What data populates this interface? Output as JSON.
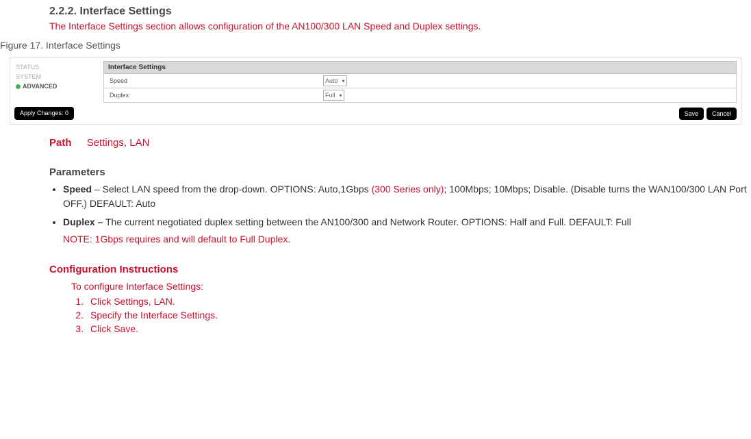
{
  "heading": "2.2.2. Interface Settings",
  "heading_subtext": "The Interface Settings section allows configuration of the AN100/300 LAN Speed and Duplex settings.",
  "figure_caption": "Figure 17. Interface Settings",
  "screenshot": {
    "nav": {
      "item1": "STATUS",
      "item2": "SYSTEM",
      "item3": "ADVANCED"
    },
    "panel_title": "Interface Settings",
    "row1_label": "Speed",
    "row1_value": "Auto",
    "row2_label": "Duplex",
    "row2_value": "Full",
    "apply_btn": "Apply Changes: 0",
    "save_btn": "Save",
    "cancel_btn": "Cancel"
  },
  "path": {
    "label": "Path",
    "value": "Settings, LAN"
  },
  "params_heading": "Parameters",
  "params": {
    "speed_label": "Speed",
    "speed_text1": " – Select LAN speed from the drop-down. OPTIONS: Auto,1Gbps ",
    "speed_red": "(300 Series only)",
    "speed_text2": "; 100Mbps; 10Mbps; Disable. (Disable turns the WAN100/300 LAN Port OFF.) DEFAULT: Auto",
    "duplex_label": "Duplex –",
    "duplex_text": " The current negotiated duplex setting between the AN100/300 and Network Router. OPTIONS: Half and Full. DEFAULT: Full",
    "note": "NOTE: 1Gbps requires and will default to Full Duplex."
  },
  "config_heading": "Configuration Instructions",
  "config_intro": "To configure Interface Settings:",
  "steps": {
    "s1": "Click Settings, LAN.",
    "s2": "Specify the Interface Settings.",
    "s3": "Click Save."
  }
}
